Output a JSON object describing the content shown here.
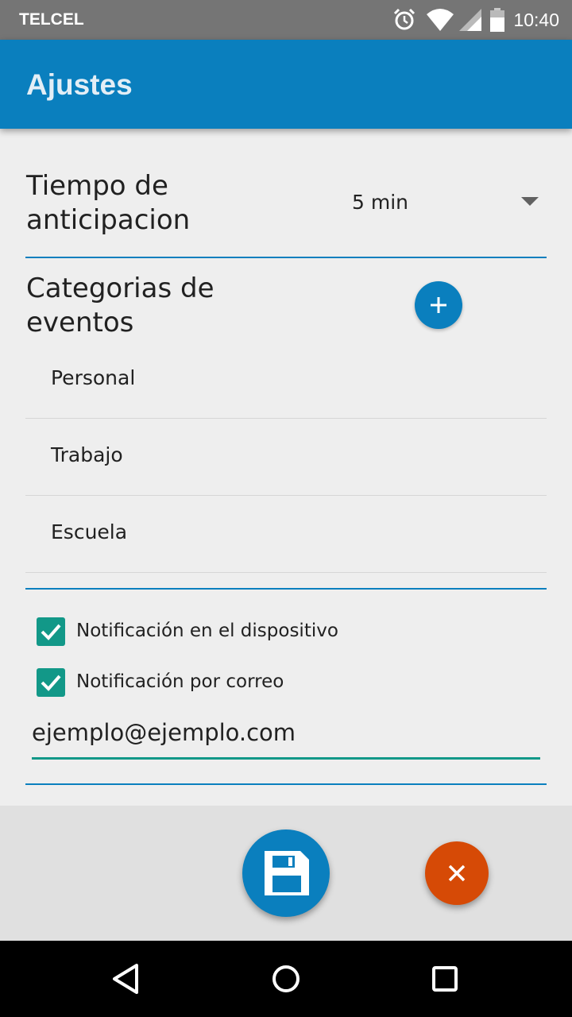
{
  "status_bar": {
    "carrier": "TELCEL",
    "time": "10:40",
    "icons": [
      "alarm-icon",
      "wifi-icon",
      "signal-icon",
      "battery-icon"
    ]
  },
  "app_bar": {
    "title": "Ajustes"
  },
  "settings": {
    "advance_time": {
      "label": "Tiempo de anticipacion",
      "value": "5 min"
    },
    "categories": {
      "label": "Categorias de eventos",
      "add_icon": "plus-icon",
      "items": [
        {
          "label": "Personal"
        },
        {
          "label": "Trabajo"
        },
        {
          "label": "Escuela"
        }
      ]
    },
    "notifications": {
      "device": {
        "label": "Notificación en el dispositivo",
        "checked": true
      },
      "email": {
        "label": "Notificación por correo",
        "checked": true
      },
      "email_address": "ejemplo@ejemplo.com"
    }
  },
  "actions": {
    "save_icon": "save-icon",
    "cancel_icon": "close-icon"
  },
  "nav": {
    "icons": [
      "back-icon",
      "home-icon",
      "recents-icon"
    ]
  },
  "colors": {
    "primary": "#0a7fbe",
    "accent_checkbox": "#129888",
    "cancel": "#d64a06",
    "status_bar": "#757575",
    "background": "#eeeeee"
  }
}
